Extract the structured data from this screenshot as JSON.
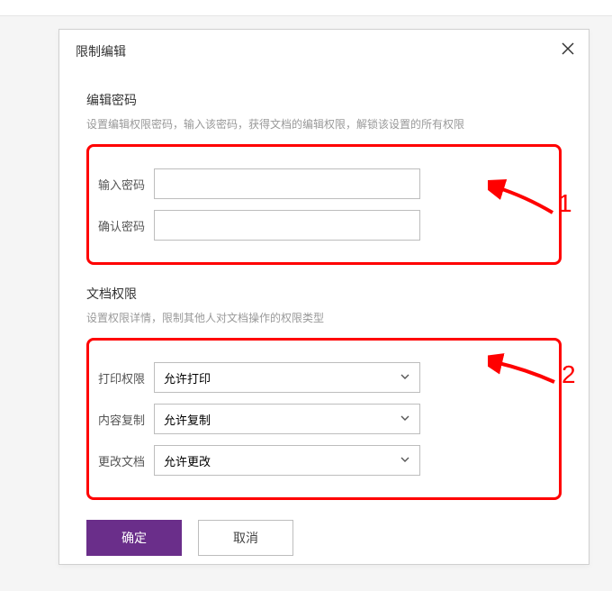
{
  "dialog": {
    "title": "限制编辑"
  },
  "section1": {
    "title": "编辑密码",
    "desc": "设置编辑权限密码，输入该密码，获得文档的编辑权限，解锁该设置的所有权限",
    "enterPasswordLabel": "输入密码",
    "confirmPasswordLabel": "确认密码"
  },
  "section2": {
    "title": "文档权限",
    "desc": "设置权限详情，限制其他人对文档操作的权限类型",
    "printLabel": "打印权限",
    "printValue": "允许打印",
    "copyLabel": "内容复制",
    "copyValue": "允许复制",
    "modifyLabel": "更改文档",
    "modifyValue": "允许更改"
  },
  "buttons": {
    "ok": "确定",
    "cancel": "取消"
  },
  "annotations": {
    "n1": "1",
    "n2": "2"
  }
}
